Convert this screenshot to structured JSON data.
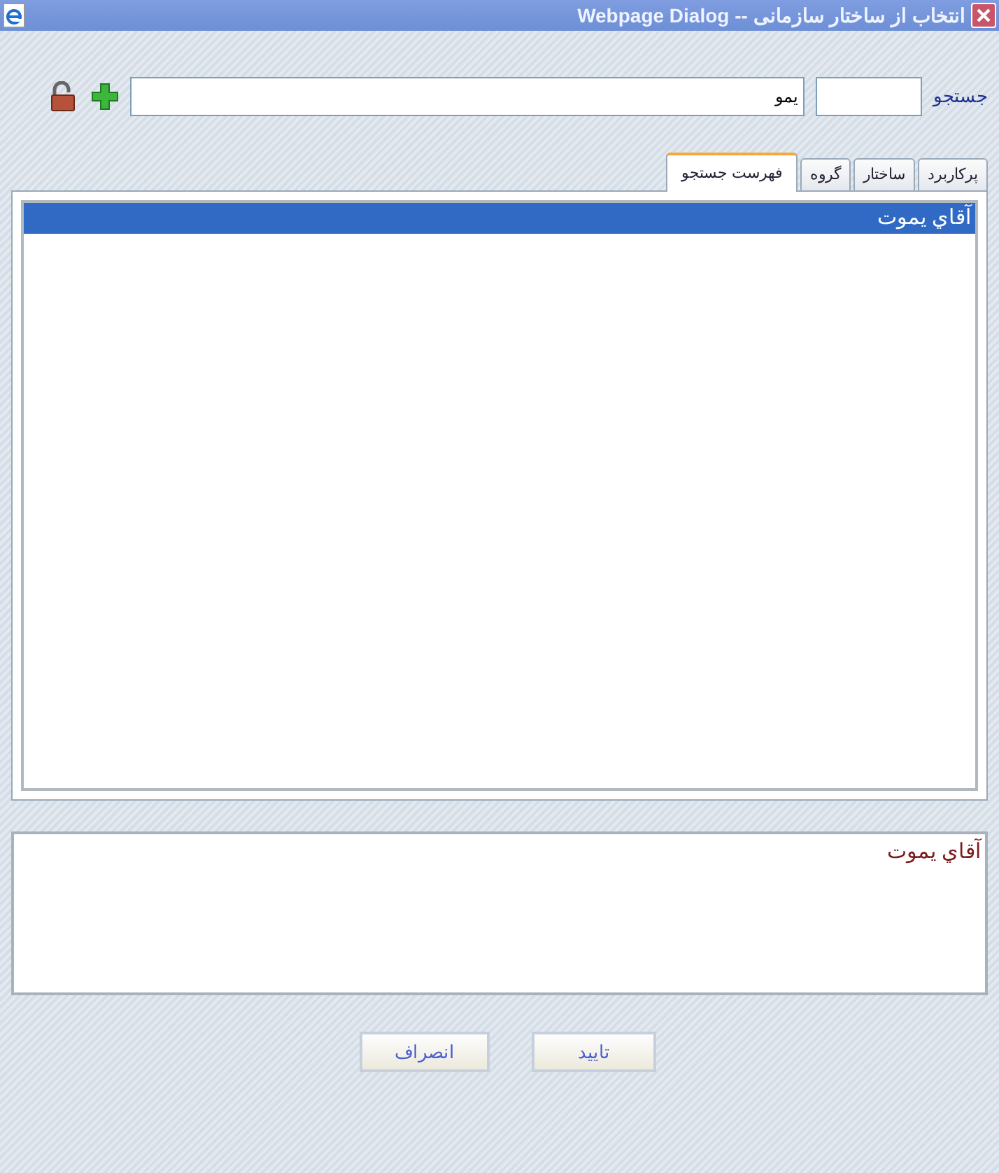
{
  "window": {
    "title": "انتخاب از ساختار سازمانی -- Webpage Dialog"
  },
  "search": {
    "label": "جستجو",
    "name_field": {
      "value": "يمو"
    }
  },
  "tabs": [
    {
      "label": "پرکاربرد",
      "selected": false
    },
    {
      "label": "ساختار",
      "selected": false
    },
    {
      "label": "گروه",
      "selected": false
    },
    {
      "label": "فهرست جستجو",
      "selected": true
    }
  ],
  "results": [
    {
      "label": "آقاي يموت",
      "selected": true
    }
  ],
  "chosen": [
    {
      "label": "آقاي يموت"
    }
  ],
  "buttons": [
    {
      "label": "تایید"
    },
    {
      "label": "انصراف"
    }
  ]
}
